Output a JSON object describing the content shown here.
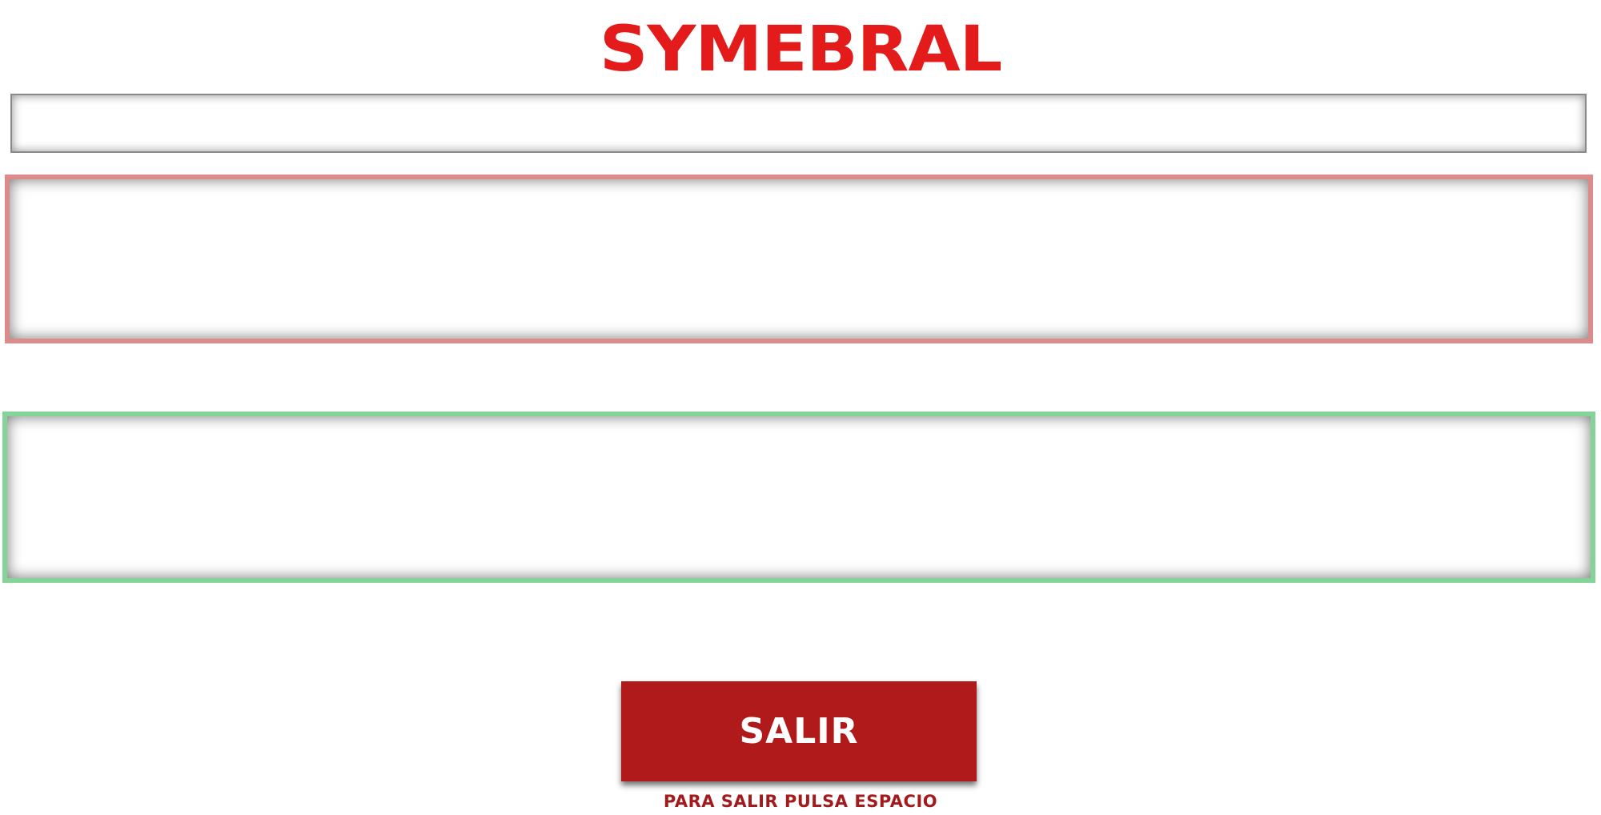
{
  "app": {
    "logo_text": "SYMEBRAL",
    "logo_color": "#e41b1b"
  },
  "input": {
    "value": "",
    "placeholder": ""
  },
  "panels": {
    "incorrect_border_color": "#dd8a8a",
    "correct_border_color": "#86d39a"
  },
  "exit": {
    "button_label": "SALIR",
    "button_color": "#b01a1a",
    "hint": "PARA SALIR PULSA ESPACIO"
  }
}
